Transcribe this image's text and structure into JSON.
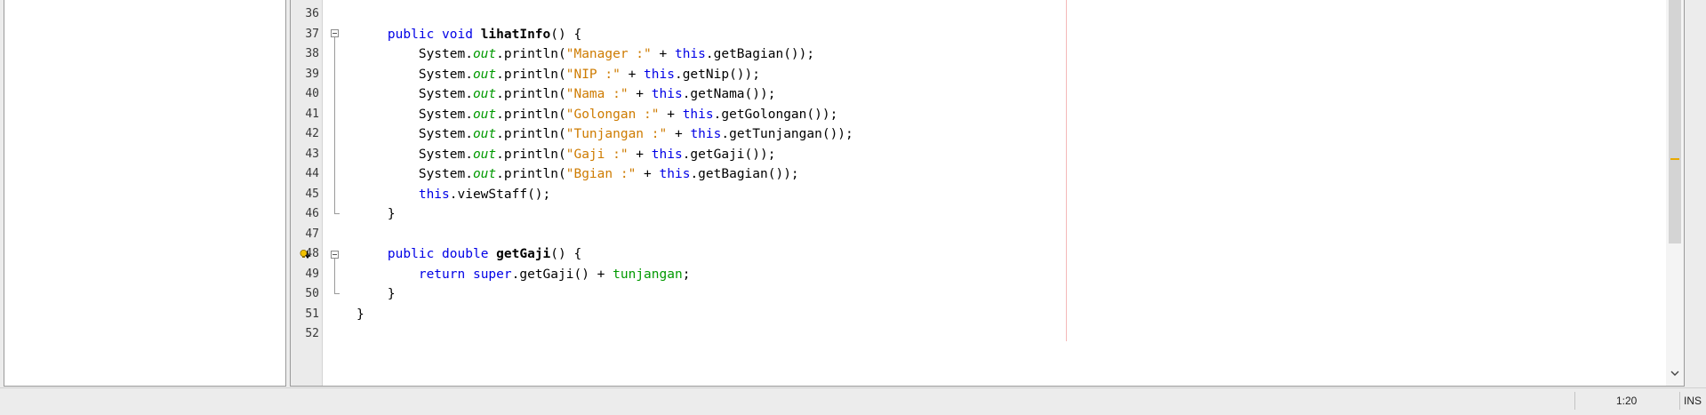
{
  "editor": {
    "lines": [
      {
        "num": "36",
        "tokens": []
      },
      {
        "num": "37",
        "tokens": [
          {
            "t": "    "
          },
          {
            "t": "public",
            "c": "kw"
          },
          {
            "t": " "
          },
          {
            "t": "void",
            "c": "kw"
          },
          {
            "t": " "
          },
          {
            "t": "lihatInfo",
            "c": "bold"
          },
          {
            "t": "() {"
          }
        ]
      },
      {
        "num": "38",
        "tokens": [
          {
            "t": "        System."
          },
          {
            "t": "out",
            "c": "fld"
          },
          {
            "t": ".println("
          },
          {
            "t": "\"Manager :\"",
            "c": "str"
          },
          {
            "t": " + "
          },
          {
            "t": "this",
            "c": "kw"
          },
          {
            "t": ".getBagian());"
          }
        ]
      },
      {
        "num": "39",
        "tokens": [
          {
            "t": "        System."
          },
          {
            "t": "out",
            "c": "fld"
          },
          {
            "t": ".println("
          },
          {
            "t": "\"NIP :\"",
            "c": "str"
          },
          {
            "t": " + "
          },
          {
            "t": "this",
            "c": "kw"
          },
          {
            "t": ".getNip());"
          }
        ]
      },
      {
        "num": "40",
        "tokens": [
          {
            "t": "        System."
          },
          {
            "t": "out",
            "c": "fld"
          },
          {
            "t": ".println("
          },
          {
            "t": "\"Nama :\"",
            "c": "str"
          },
          {
            "t": " + "
          },
          {
            "t": "this",
            "c": "kw"
          },
          {
            "t": ".getNama());"
          }
        ]
      },
      {
        "num": "41",
        "tokens": [
          {
            "t": "        System."
          },
          {
            "t": "out",
            "c": "fld"
          },
          {
            "t": ".println("
          },
          {
            "t": "\"Golongan :\"",
            "c": "str"
          },
          {
            "t": " + "
          },
          {
            "t": "this",
            "c": "kw"
          },
          {
            "t": ".getGolongan());"
          }
        ]
      },
      {
        "num": "42",
        "tokens": [
          {
            "t": "        System."
          },
          {
            "t": "out",
            "c": "fld"
          },
          {
            "t": ".println("
          },
          {
            "t": "\"Tunjangan :\"",
            "c": "str"
          },
          {
            "t": " + "
          },
          {
            "t": "this",
            "c": "kw"
          },
          {
            "t": ".getTunjangan());"
          }
        ]
      },
      {
        "num": "43",
        "tokens": [
          {
            "t": "        System."
          },
          {
            "t": "out",
            "c": "fld"
          },
          {
            "t": ".println("
          },
          {
            "t": "\"Gaji :\"",
            "c": "str"
          },
          {
            "t": " + "
          },
          {
            "t": "this",
            "c": "kw"
          },
          {
            "t": ".getGaji());"
          }
        ]
      },
      {
        "num": "44",
        "tokens": [
          {
            "t": "        System."
          },
          {
            "t": "out",
            "c": "fld"
          },
          {
            "t": ".println("
          },
          {
            "t": "\"Bgian :\"",
            "c": "str"
          },
          {
            "t": " + "
          },
          {
            "t": "this",
            "c": "kw"
          },
          {
            "t": ".getBagian());"
          }
        ]
      },
      {
        "num": "45",
        "tokens": [
          {
            "t": "        "
          },
          {
            "t": "this",
            "c": "kw"
          },
          {
            "t": ".viewStaff();"
          }
        ]
      },
      {
        "num": "46",
        "tokens": [
          {
            "t": "    }"
          }
        ]
      },
      {
        "num": "47",
        "tokens": []
      },
      {
        "num": "48",
        "tokens": [
          {
            "t": "    "
          },
          {
            "t": "public",
            "c": "kw"
          },
          {
            "t": " "
          },
          {
            "t": "double",
            "c": "kw"
          },
          {
            "t": " "
          },
          {
            "t": "getGaji",
            "c": "bold"
          },
          {
            "t": "() {"
          }
        ]
      },
      {
        "num": "49",
        "tokens": [
          {
            "t": "        "
          },
          {
            "t": "return",
            "c": "kw"
          },
          {
            "t": " "
          },
          {
            "t": "super",
            "c": "kw"
          },
          {
            "t": ".getGaji() + "
          },
          {
            "t": "tunjangan",
            "c": "var"
          },
          {
            "t": ";"
          }
        ]
      },
      {
        "num": "50",
        "tokens": [
          {
            "t": "    }"
          }
        ]
      },
      {
        "num": "51",
        "tokens": [
          {
            "t": "}"
          }
        ]
      },
      {
        "num": "52",
        "tokens": []
      }
    ]
  },
  "statusbar": {
    "position": "1:20",
    "mode": "INS"
  },
  "icons": {
    "fold": "fold-collapse-icon",
    "hint": "override-hint-icon",
    "scroll_down": "chevron-down-icon"
  },
  "colors": {
    "keyword": "#0000e6",
    "string": "#ce7b00",
    "field": "#009900",
    "margin_line": "#f4b8b8",
    "warning_mark": "#e8a900"
  }
}
